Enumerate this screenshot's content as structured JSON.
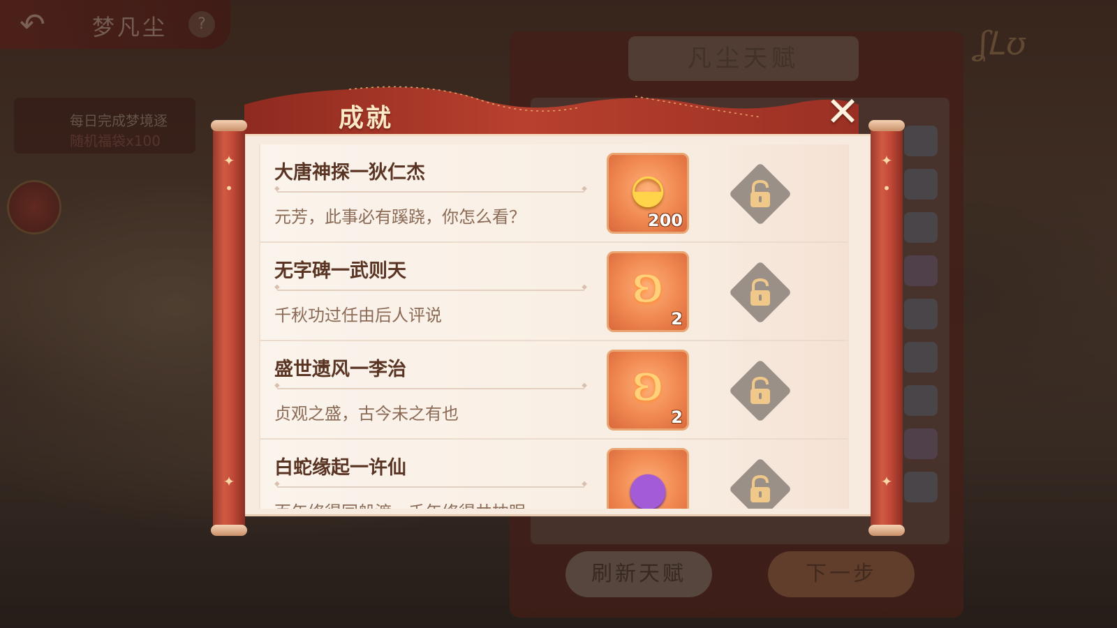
{
  "background": {
    "back_icon": "back-arrow-icon",
    "title": "梦凡尘",
    "help_icon": "question-icon",
    "task_line1": "每日完成梦境逐",
    "task_line2": "随机福袋x100",
    "panel_title": "凡尘天赋",
    "refresh_button": "刷新天赋",
    "next_button": "下一步"
  },
  "modal": {
    "title": "成就",
    "close_icon": "close-icon"
  },
  "achievements": [
    {
      "title": "大唐神探一狄仁杰",
      "description": "元芳，此事必有蹊跷，你怎么看？",
      "reward_icon": "gold-ingot-icon",
      "reward_count": "200",
      "status_icon": "lock-icon"
    },
    {
      "title": "无字碑一武则天",
      "description": "千秋功过任由后人评说",
      "reward_icon": "jade-pendant-icon",
      "reward_count": "2",
      "status_icon": "lock-icon"
    },
    {
      "title": "盛世遗风一李治",
      "description": "贞观之盛，古今未之有也",
      "reward_icon": "jade-pendant-icon",
      "reward_count": "2",
      "status_icon": "lock-icon"
    },
    {
      "title": "白蛇缘起一许仙",
      "description": "百年修得同船渡，千年修得共枕眠",
      "reward_icon": "purple-pouch-icon",
      "reward_count": "",
      "status_icon": "lock-icon"
    }
  ],
  "colors": {
    "scroll_red": "#c44a38",
    "paper": "#f7ebdf",
    "title_text": "#5a3423",
    "desc_text": "#8b6a55"
  }
}
